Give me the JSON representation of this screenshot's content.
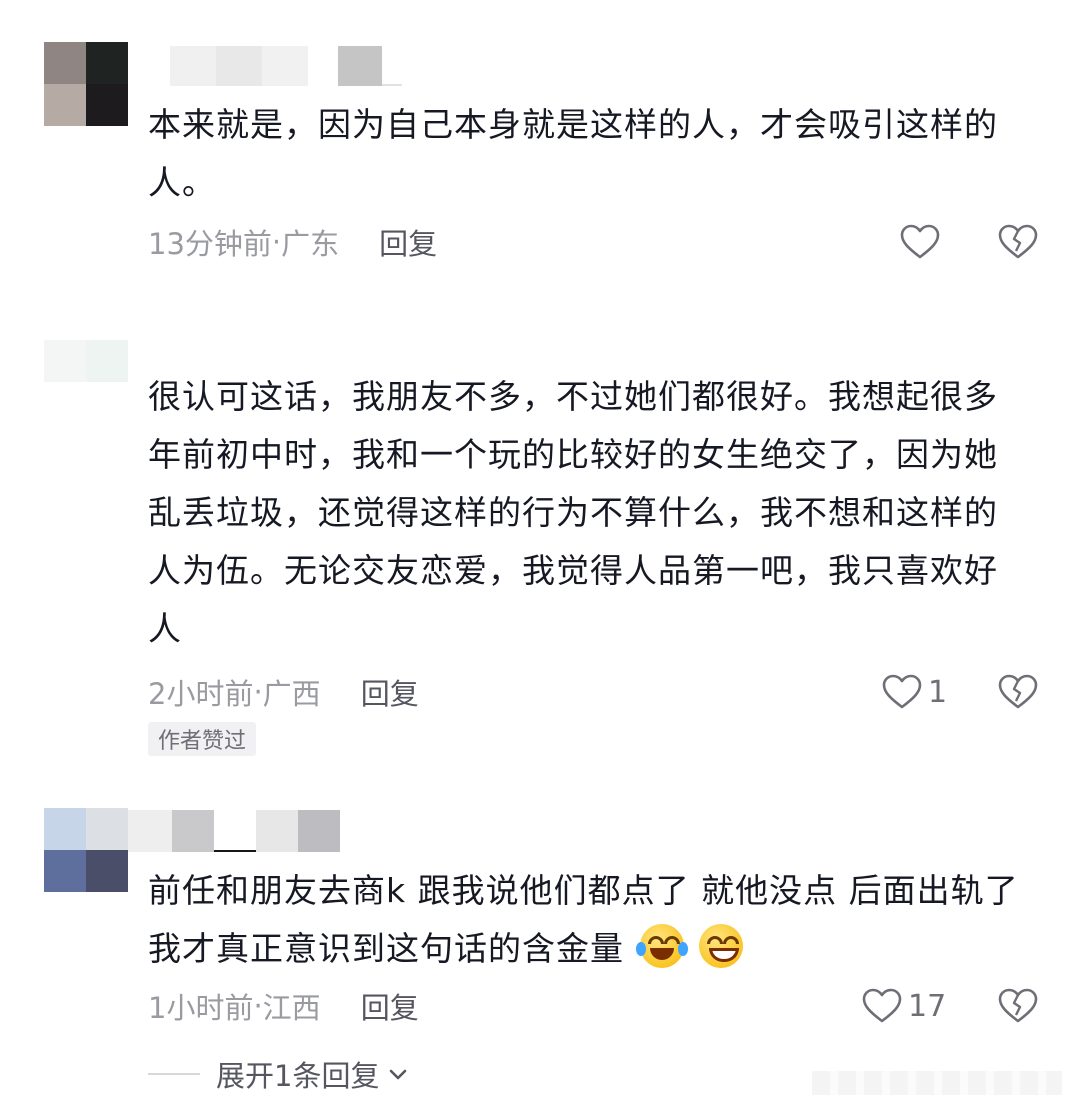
{
  "comments": [
    {
      "text": "本来就是，因为自己本身就是这样的人，才会吸引这样的人。",
      "time": "13分钟前",
      "location": "广东",
      "reply_label": "回复",
      "like_count": ""
    },
    {
      "text": "很认可这话，我朋友不多，不过她们都很好。我想起很多年前初中时，我和一个玩的比较好的女生绝交了，因为她乱丢垃圾，还觉得这样的行为不算什么，我不想和这样的人为伍。无论交友恋爱，我觉得人品第一吧，我只喜欢好人",
      "time": "2小时前",
      "location": "广西",
      "reply_label": "回复",
      "like_count": "1",
      "author_tag": "作者赞过"
    },
    {
      "text": "前任和朋友去商k 跟我说他们都点了 就他没点 后面出轨了 我才真正意识到这句话的含金量",
      "time": "1小时前",
      "location": "江西",
      "reply_label": "回复",
      "like_count": "17",
      "emojis": [
        "crying-laughing-emoji",
        "grinning-emoji"
      ]
    }
  ],
  "expand_replies": "展开1条回复",
  "meta_separator": " · ",
  "colors": {
    "text": "#161823",
    "meta": "#9a9ba0",
    "reply": "#555660",
    "icon": "#6e6f76",
    "tag_bg": "#f1f1f3"
  }
}
